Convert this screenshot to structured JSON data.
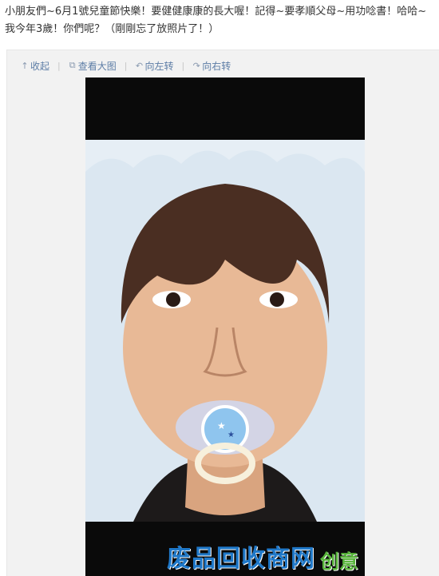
{
  "post": {
    "text": "小朋友們~6月1號兒童節快樂！要健健康康的長大喔！記得~要孝順父母~用功唸書！哈哈~我今年3歲！你們呢？（剛剛忘了放照片了！）"
  },
  "toolbar": {
    "items": [
      {
        "label": "收起",
        "icon": "arrow-up-icon"
      },
      {
        "label": "查看大图",
        "icon": "external-view-icon"
      },
      {
        "label": "向左转",
        "icon": "rotate-left-icon"
      },
      {
        "label": "向右转",
        "icon": "rotate-right-icon"
      }
    ],
    "separator": "|"
  },
  "photo": {
    "subject": "face-with-pacifier-illustration",
    "background": "#0a0a0a"
  },
  "watermark": {
    "main": "废品回收商网",
    "side": "创意",
    "main_color": "#1f78c8",
    "side_color": "#57b43a"
  },
  "colors": {
    "link": "#5d7da6",
    "text": "#333333",
    "panel": "#f2f2f2"
  }
}
